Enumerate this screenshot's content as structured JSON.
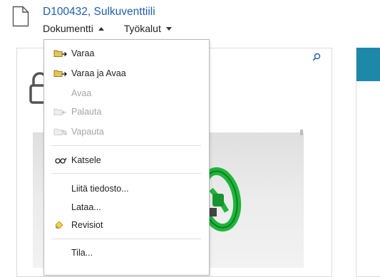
{
  "header": {
    "title": "D100432, Sulkuventtiili",
    "menus": [
      {
        "label": "Dokumentti",
        "expanded": true
      },
      {
        "label": "Työkalut",
        "expanded": false
      }
    ]
  },
  "dropdown": {
    "items": [
      {
        "label": "Varaa",
        "icon": "folder-arrow-icon",
        "enabled": true
      },
      {
        "label": "Varaa ja Avaa",
        "icon": "folder-arrow-icon",
        "enabled": true
      },
      {
        "label": "Avaa",
        "icon": "",
        "enabled": false
      },
      {
        "label": "Palauta",
        "icon": "folder-return-icon",
        "enabled": false
      },
      {
        "label": "Vapauta",
        "icon": "folder-release-icon",
        "enabled": false
      },
      {
        "label": "Katsele",
        "icon": "glasses-icon",
        "enabled": true
      },
      {
        "label": "Liitä tiedosto...",
        "icon": "",
        "enabled": true
      },
      {
        "label": "Lataa...",
        "icon": "",
        "enabled": true
      },
      {
        "label": "Revisiot",
        "icon": "revisions-icon",
        "enabled": true
      },
      {
        "label": "Tila...",
        "icon": "",
        "enabled": true
      }
    ]
  },
  "colors": {
    "title": "#1f5fa8",
    "accent": "#1e88a8",
    "disabled_text": "#a5a5a5",
    "valve": "#1fb53a"
  }
}
